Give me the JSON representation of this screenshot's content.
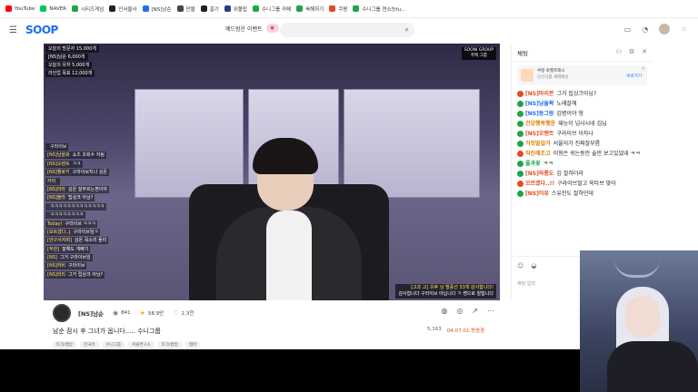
{
  "bookmarks": [
    {
      "label": "YouTube",
      "color": "#ff0000"
    },
    {
      "label": "NAVER",
      "color": "#03c75a"
    },
    {
      "label": "시티즈게임",
      "color": "#1ea54a"
    },
    {
      "label": "인서울사",
      "color": "#222222"
    },
    {
      "label": "[NS]남순",
      "color": "#1d6cf2"
    },
    {
      "label": "만물",
      "color": "#444444"
    },
    {
      "label": "흥기",
      "color": "#222222"
    },
    {
      "label": "위폴립",
      "color": "#2d3a8c"
    },
    {
      "label": "수니그룹 카페",
      "color": "#1ea54a"
    },
    {
      "label": "육해하기",
      "color": "#1ea54a"
    },
    {
      "label": "쿠팡",
      "color": "#e34b20"
    },
    {
      "label": "수니그룹 연소능fu...",
      "color": "#1ea54a"
    }
  ],
  "header": {
    "logo": "SOOP",
    "promo_label": "예드범운 이벤트",
    "search_placeholder": ""
  },
  "stream_overlay": {
    "stats": [
      "오늘의 방문자 15,000개",
      "[NS]남순 6,000개",
      "오늘의 유저 5,000개",
      "라인업 목표 12,000개"
    ],
    "top_right_line1": "SOONI GROUP",
    "top_right_line2": "흑백 그룹",
    "chat_lines": [
      {
        "nick": "",
        "text": "구라이브"
      },
      {
        "nick": "[NS]남을봐",
        "text": "쇼츠 조회수 지림"
      },
      {
        "nick": "[NS]오렌트",
        "text": "ㅋㅋ"
      },
      {
        "nick": "[NS]헬로키",
        "text": "구라이브지나 김온"
      },
      {
        "nick": "카라",
        "text": ""
      },
      {
        "nick": "[NS]라라",
        "text": "김은 잘부르는편이야"
      },
      {
        "nick": "[NS]블라",
        "text": "팁싱크 아님?"
      },
      {
        "nick": "",
        "text": "ㅋㅋㅋㅋㅋㅋㅋㅋㅋㅋㅋㅋㅋ"
      },
      {
        "nick": "",
        "text": "ㅋㅋㅋㅋㅋㅋㅋㅋ"
      },
      {
        "nick": "Today!",
        "text": "구라이브 ㅋㅋㅋ"
      },
      {
        "nick": "[모르겠다..]",
        "text": "구라이브임ㅋ"
      },
      {
        "nick": "[안구서지며]",
        "text": "김온 목소리 들려"
      },
      {
        "nick": "[무관]",
        "text": "잘해도 개뼈기"
      },
      {
        "nick": "[NS]",
        "text": "그거 구라이브임"
      },
      {
        "nick": "[NS]하비",
        "text": "구라이브"
      },
      {
        "nick": "[NS]라리",
        "text": "그거 립싱크 아님?"
      }
    ],
    "bottom_right_line1": "[고조 고] 유후 님 별풍선 33개 감사합니다!",
    "bottom_right_line2": "감사합니다 구라이브 아닙니다 ㅋ 쌩으로 찰합니다"
  },
  "channel": {
    "name": "[NS]남순",
    "viewers": "841",
    "stars": "58.9만",
    "likes": "2.3천",
    "title": "남순 잠시 후 그녀가 옵니다..... 수니그룹",
    "views": "5,163",
    "duration": "04:07:01 방송중",
    "tags": [
      "토크/캠방",
      "한국어",
      "수니그룹",
      "서울연구소",
      "토크/캠방",
      "멤버"
    ]
  },
  "chat": {
    "title": "채팅",
    "notice_title": "쿠팡 로켓프레시",
    "notice_sub": "신선식품 새벽배송",
    "notice_link": "바로가기",
    "input_placeholder": "채팅 입력",
    "messages": [
      {
        "badge": "#e34b20",
        "nick": "[NS]마리몬",
        "nick_color": "#e34b20",
        "text": "그거 립싱크아님?"
      },
      {
        "badge": "#1ea54a",
        "nick": "[NS]남들꽉",
        "nick_color": "#1d6cf2",
        "text": "노래잘해"
      },
      {
        "badge": "#1ea54a",
        "nick": "[NS]동그랑",
        "nick_color": "#1d6cf2",
        "text": "김병이야 형"
      },
      {
        "badge": "#1ea54a",
        "nick": "건강행복행운",
        "nick_color": "#e07b00",
        "text": "재능이 넘사시네 김님"
      },
      {
        "badge": "#1ea54a",
        "nick": "[NS]오렌트",
        "nick_color": "#e34b20",
        "text": "구라이브 이자나"
      },
      {
        "badge": "#1ea54a",
        "nick": "거짓말걸거",
        "nick_color": "#e07b00",
        "text": "서울이가 진짜잘부름"
      },
      {
        "badge": "#e34b20",
        "nick": "직진레조고",
        "nick_color": "#e07b00",
        "text": "이형은 쉬는동안 술만 보고있었네 ㅋㅋ"
      },
      {
        "badge": "#1ea54a",
        "nick": "풀과꽃",
        "nick_color": "#1ea54a",
        "text": "ㅋㅋ"
      },
      {
        "badge": "#1ea54a",
        "nick": "[NS]와룡도",
        "nick_color": "#e34b20",
        "text": "김 잘하더라"
      },
      {
        "badge": "#e34b20",
        "nick": "모르겠다..!!",
        "nick_color": "#e34b20",
        "text": "구라이브말고 욱타브 맞아"
      },
      {
        "badge": "#1ea54a",
        "nick": "[NS]이유",
        "nick_color": "#e34b20",
        "text": "스유진도 잘하던데"
      }
    ]
  }
}
